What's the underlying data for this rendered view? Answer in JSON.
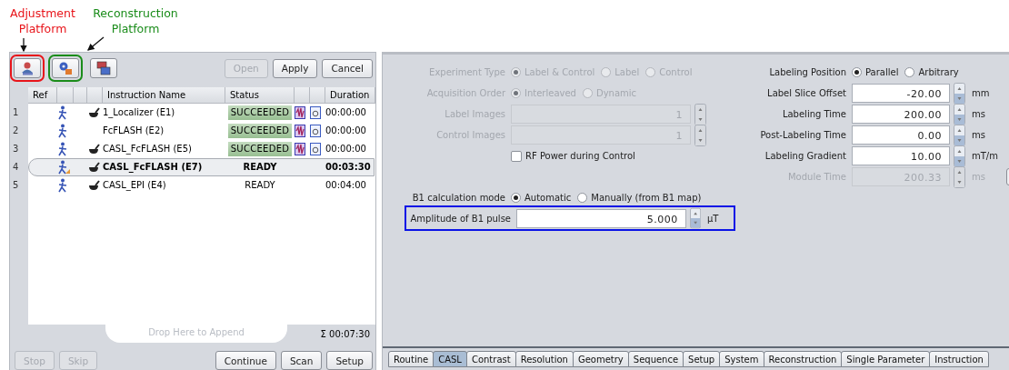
{
  "annotations": [
    {
      "text": "Adjustment Platform",
      "color": "#e8141a"
    },
    {
      "text": "Reconstruction Platform",
      "color": "#1a8c1a"
    }
  ],
  "platform_buttons": [
    {
      "kind": "adjustment"
    },
    {
      "kind": "reconstruction"
    },
    {
      "kind": "display"
    }
  ],
  "toolbar_buttons": [
    {
      "label": "Open",
      "disabled": true
    },
    {
      "label": "Apply",
      "disabled": false
    },
    {
      "label": "Cancel",
      "disabled": false
    }
  ],
  "table": {
    "columns": [
      "Ref",
      "Instruction Name",
      "Status",
      "Duration"
    ],
    "rows": [
      {
        "number": "1",
        "name": "1_Localizer (E1)",
        "gear": true,
        "status": "SUCCEEDED",
        "kind": "succeeded",
        "duration": "00:00:00",
        "selected": false
      },
      {
        "number": "2",
        "name": "FcFLASH (E2)",
        "gear": false,
        "status": "SUCCEEDED",
        "kind": "succeeded",
        "duration": "00:00:00",
        "selected": false
      },
      {
        "number": "3",
        "name": "CASL_FcFLASH (E5)",
        "gear": true,
        "status": "SUCCEEDED",
        "kind": "succeeded",
        "duration": "00:00:00",
        "selected": false
      },
      {
        "number": "4",
        "name": "CASL_FcFLASH (E7)",
        "gear": true,
        "status": "READY",
        "kind": "ready",
        "duration": "00:03:30",
        "selected": true
      },
      {
        "number": "5",
        "name": "CASL_EPI (E4)",
        "gear": true,
        "status": "READY",
        "kind": "ready",
        "duration": "00:04:00",
        "selected": false
      }
    ]
  },
  "drop_hint": "Drop Here to Append",
  "total_duration": "Σ 00:07:30",
  "bottom_left_buttons": [
    {
      "label": "Stop",
      "disabled": true
    },
    {
      "label": "Skip",
      "disabled": true
    }
  ],
  "bottom_right_buttons": [
    {
      "label": "Continue",
      "disabled": false
    },
    {
      "label": "Scan",
      "disabled": false
    },
    {
      "label": "Setup",
      "disabled": false
    }
  ],
  "left_form": [
    {
      "kind": "radio",
      "label": "Experiment Type",
      "disabled": true,
      "options": [
        {
          "label": "Label & Control",
          "selected": true
        },
        {
          "label": "Label",
          "selected": false
        },
        {
          "label": "Control",
          "selected": false
        }
      ]
    },
    {
      "kind": "radio",
      "label": "Acquisition Order",
      "disabled": true,
      "options": [
        {
          "label": "Interleaved",
          "selected": true
        },
        {
          "label": "Dynamic",
          "selected": false
        }
      ]
    },
    {
      "kind": "spinner",
      "label": "Label Images",
      "disabled": true,
      "value": "1"
    },
    {
      "kind": "spinner",
      "label": "Control Images",
      "disabled": true,
      "value": "1"
    },
    {
      "kind": "checkbox",
      "label": "RF Power during Control",
      "disabled": false,
      "checked": false
    }
  ],
  "b1_form": [
    {
      "kind": "radio",
      "label": "B1 calculation mode",
      "disabled": false,
      "options": [
        {
          "label": "Automatic",
          "selected": true
        },
        {
          "label": "Manually (from B1 map)",
          "selected": false
        }
      ]
    },
    {
      "kind": "spinner",
      "label": "Amplitude of B1 pulse",
      "disabled": false,
      "value": "5.000",
      "unit": "µT",
      "outlined": true
    }
  ],
  "right_form": [
    {
      "kind": "radio",
      "label": "Labeling Position",
      "disabled": false,
      "options": [
        {
          "label": "Parallel",
          "selected": true
        },
        {
          "label": "Arbitrary",
          "selected": false
        }
      ]
    },
    {
      "kind": "spinner",
      "label": "Label Slice Offset",
      "disabled": false,
      "value": "-20.00",
      "unit": "mm"
    },
    {
      "kind": "spinner",
      "label": "Labeling Time",
      "disabled": false,
      "value": "200.00",
      "unit": "ms"
    },
    {
      "kind": "spinner",
      "label": "Post-Labeling Time",
      "disabled": false,
      "value": "0.00",
      "unit": "ms"
    },
    {
      "kind": "spinner",
      "label": "Labeling Gradient",
      "disabled": false,
      "value": "10.00",
      "unit": "mT/m"
    },
    {
      "kind": "spinner",
      "label": "Module Time",
      "disabled": true,
      "value": "200.33",
      "unit": "ms",
      "more": true
    }
  ],
  "tabs": [
    {
      "label": "Routine",
      "selected": false
    },
    {
      "label": "CASL",
      "selected": true
    },
    {
      "label": "Contrast",
      "selected": false
    },
    {
      "label": "Resolution",
      "selected": false
    },
    {
      "label": "Geometry",
      "selected": false
    },
    {
      "label": "Sequence",
      "selected": false
    },
    {
      "label": "Setup",
      "selected": false
    },
    {
      "label": "System",
      "selected": false
    },
    {
      "label": "Reconstruction",
      "selected": false
    },
    {
      "label": "Single Parameter",
      "selected": false
    },
    {
      "label": "Instruction",
      "selected": false
    }
  ]
}
